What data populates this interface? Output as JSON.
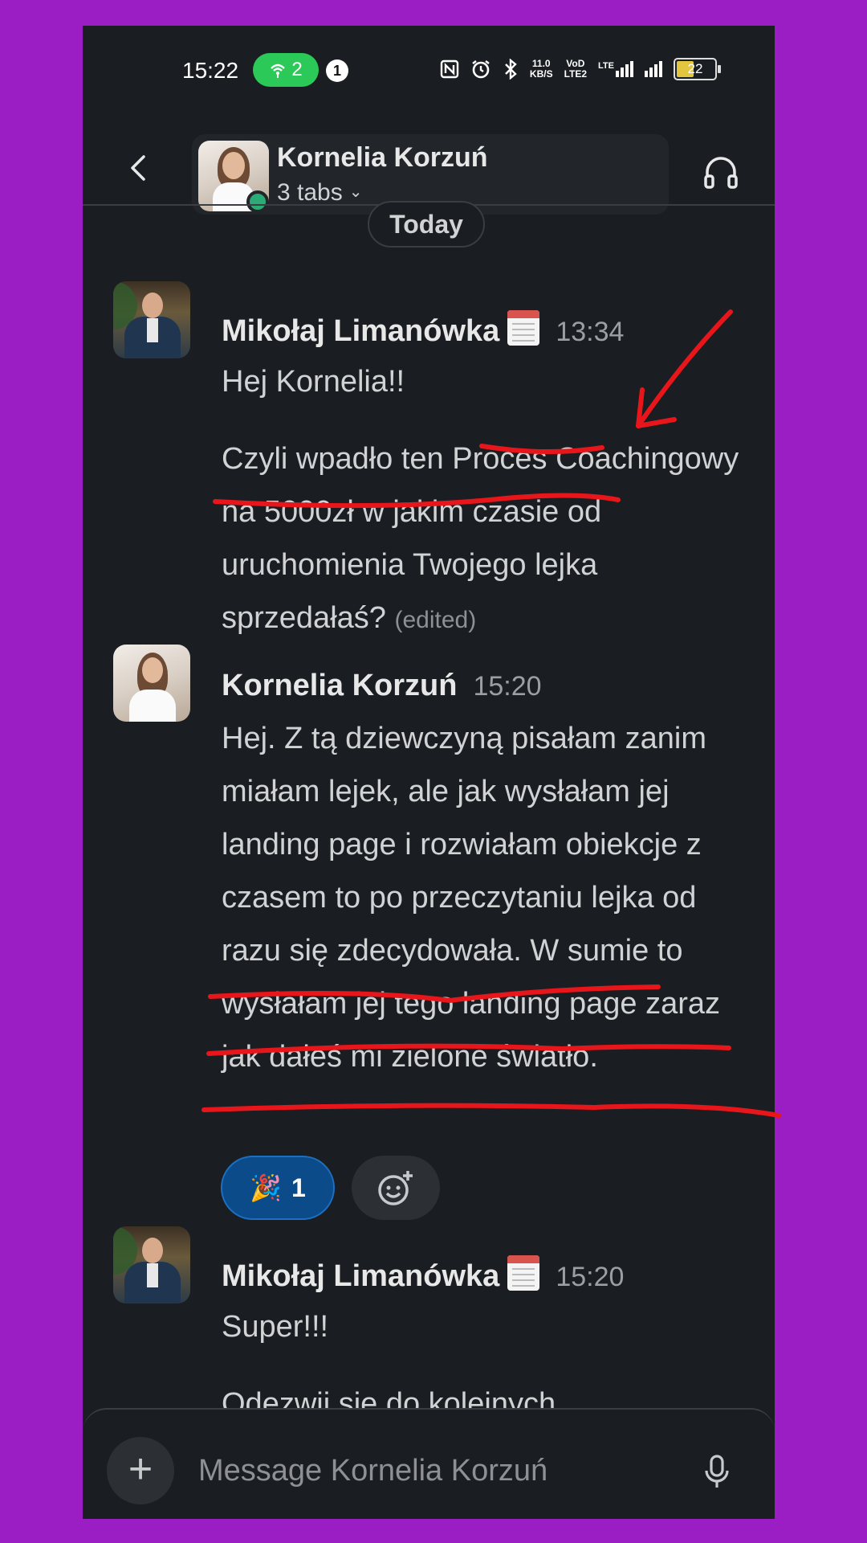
{
  "status_bar": {
    "time": "15:22",
    "hotspot_count": "2",
    "notification_count": "1",
    "net_speed_top": "11.0",
    "net_speed_bottom": "KB/S",
    "volte_top": "VoD",
    "volte_bottom": "LTE2",
    "lte_label": "LTE",
    "battery": "22"
  },
  "header": {
    "contact_name": "Kornelia Korzuń",
    "tabs_label": "3 tabs"
  },
  "date_divider": "Today",
  "messages": [
    {
      "sender": "Mikołaj Limanówka",
      "time": "13:34",
      "paragraphs": [
        "Hej Kornelia!!",
        "Czyli wpadło ten Proces Coachingowy na 5000zł w jakim czasie od uruchomienia Twojego lejka sprzedałaś?"
      ],
      "edited": "(edited)"
    },
    {
      "sender": "Kornelia Korzuń",
      "time": "15:20",
      "paragraphs": [
        "Hej. Z tą dziewczyną pisałam zanim miałam lejek, ale jak wysłałam jej landing page i rozwiałam obiekcje z czasem to po przeczytaniu lejka od razu się zdecydowała. W sumie to wysłałam jej tego landing page zaraz jak dałeś mi zielone światło."
      ],
      "reactions": [
        {
          "emoji": "🎉",
          "count": "1"
        }
      ]
    },
    {
      "sender": "Mikołaj Limanówka",
      "time": "15:20",
      "paragraphs": [
        "Super!!!",
        "Odezwij się do kolejnych"
      ]
    }
  ],
  "composer": {
    "placeholder": "Message Kornelia Korzuń"
  },
  "colors": {
    "background": "#9a1ec4",
    "app_background": "#1a1d21",
    "online": "#2bac76",
    "annotation": "#e8161b",
    "reaction_active": "#0b4b8a"
  }
}
